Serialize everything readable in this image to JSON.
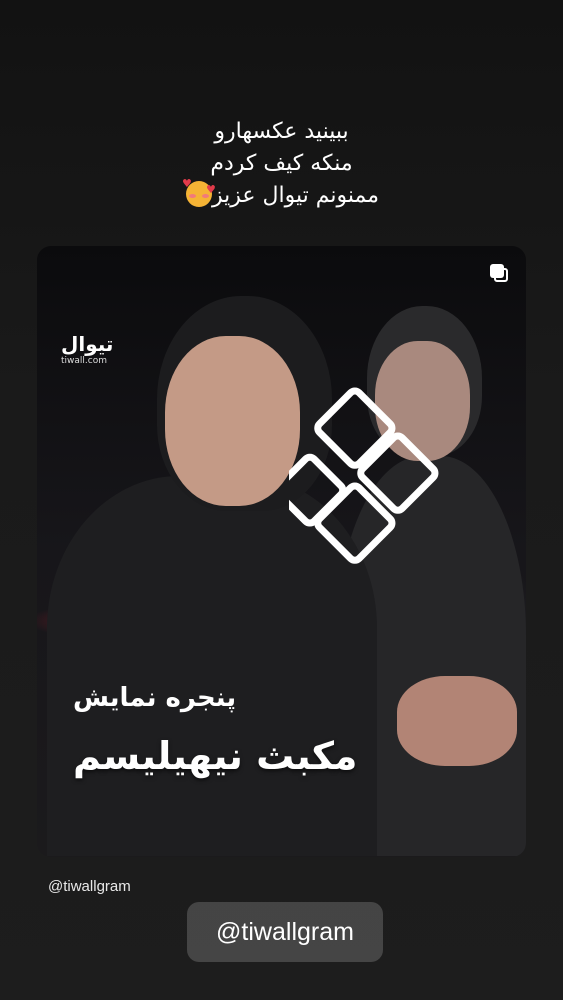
{
  "caption": {
    "line1": "ببینید عکسهارو",
    "line2": "منکه کیف کردم",
    "line3": "ممنونم تیوال عزیز",
    "emoji": "smiling-face-with-hearts-icon"
  },
  "post": {
    "brand_fa": "تیوال",
    "brand_en": "tiwall.com",
    "subtitle": "پنجره نمایش",
    "title": "مکبث نیهیلیسم",
    "multi_icon": "carousel-icon"
  },
  "username": "@tiwallgram",
  "mention_sticker": "@tiwallgram"
}
